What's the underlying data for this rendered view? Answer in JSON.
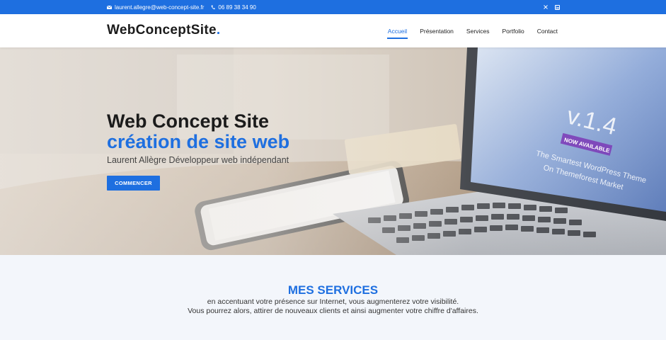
{
  "topbar": {
    "email": "laurent.allegre@web-concept-site.fr",
    "phone": "06 89 38 34 90",
    "icons": {
      "email": "envelope-icon",
      "phone": "phone-icon",
      "social_1": "social-x-icon",
      "social_2": "linkedin-icon"
    }
  },
  "header": {
    "logo": "WebConceptSite",
    "logo_dot": ".",
    "nav": [
      {
        "label": "Accueil",
        "active": true
      },
      {
        "label": "Présentation",
        "active": false
      },
      {
        "label": "Services",
        "active": false
      },
      {
        "label": "Portfolio",
        "active": false
      },
      {
        "label": "Contact",
        "active": false
      }
    ]
  },
  "hero": {
    "title": "Web Concept Site",
    "subtitle": "création de site web",
    "description": "Laurent Allègre Développeur web indépendant",
    "button": "COMMENCER",
    "screen_text": {
      "version": "v.1.4",
      "badge": "NOW AVAILABLE",
      "line1": "The Smartest WordPress Theme",
      "line2": "On Themeforest Market"
    }
  },
  "services": {
    "title": "MES SERVICES",
    "line1": "en accentuant votre présence sur Internet, vous augmenterez votre visibilité.",
    "line2": "Vous pourrez alors, attirer de nouveaux clients et ainsi augmenter votre chiffre d'affaires."
  },
  "colors": {
    "accent": "#1e6fe0",
    "dark": "#1b1b1b",
    "services_bg": "#f3f6fb"
  }
}
